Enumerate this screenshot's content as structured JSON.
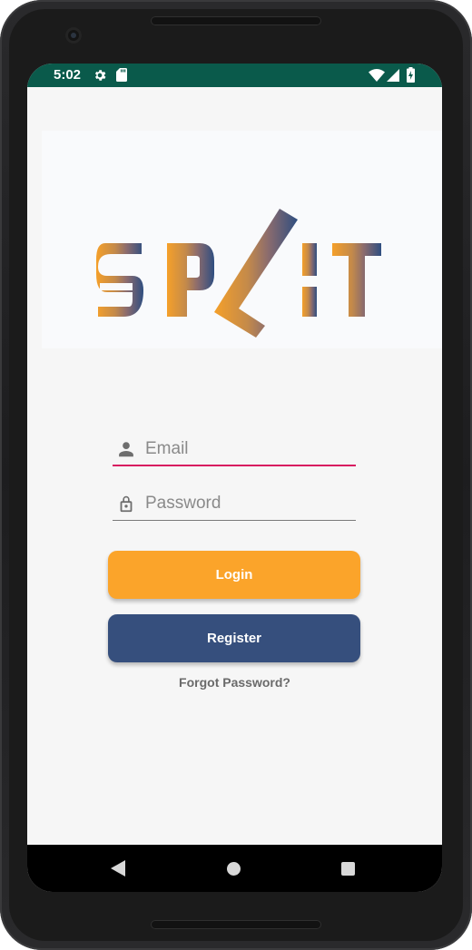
{
  "status_bar": {
    "time": "5:02",
    "icons": [
      "gear-icon",
      "sd-card-icon",
      "wifi-icon",
      "cell-signal-icon",
      "battery-icon"
    ],
    "background": "#0a5a4b"
  },
  "logo": {
    "text": "SPLIT",
    "colors": {
      "orange": "#f5a02a",
      "blue": "#2f4e80"
    }
  },
  "form": {
    "email_placeholder": "Email",
    "password_placeholder": "Password",
    "active_underline_color": "#d81b60"
  },
  "buttons": {
    "login_label": "Login",
    "register_label": "Register",
    "login_color": "#fba42a",
    "register_color": "#364f7d"
  },
  "forgot_password": "Forgot Password?",
  "nav": {
    "icons": [
      "back-icon",
      "home-icon",
      "recents-icon"
    ]
  }
}
